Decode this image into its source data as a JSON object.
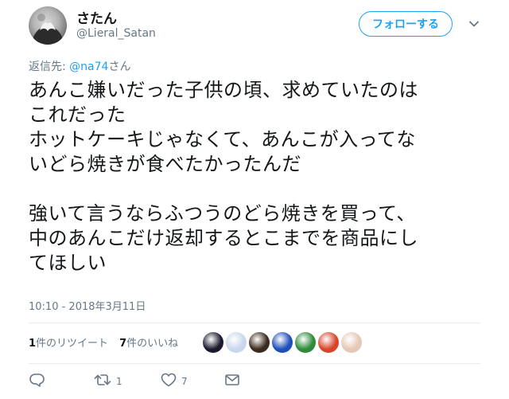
{
  "user": {
    "display_name": "さたん",
    "username": "@Lieral_Satan"
  },
  "follow_button": {
    "label": "フォローする"
  },
  "reply": {
    "prefix": "返信先: ",
    "mention": "@na74",
    "suffix": "さん"
  },
  "tweet": {
    "text": "あんこ嫌いだった子供の頃、求めていたのは\nこれだった\nホットケーキじゃなくて、あんこが入ってな\nいどら焼きが食べたかったんだ\n\n強いて言うならふつうのどら焼きを買って、\n中のあんこだけ返却するとこまでを商品にし\nてほしい",
    "timestamp": "10:10 - 2018年3月11日"
  },
  "stats": {
    "retweet_count": "1",
    "retweet_label": "件のリツイート",
    "like_count": "7",
    "like_label": "件のいいね"
  },
  "likers": [
    {
      "icon": "liker-avatar-1",
      "color": "#1a1a2e"
    },
    {
      "icon": "liker-avatar-2",
      "color": "#c9d6ec"
    },
    {
      "icon": "liker-avatar-3",
      "color": "#3b2a1e"
    },
    {
      "icon": "liker-avatar-4",
      "color": "#1f4fb8"
    },
    {
      "icon": "liker-avatar-5",
      "color": "#2e8b3a"
    },
    {
      "icon": "liker-avatar-6",
      "color": "#d8452a"
    },
    {
      "icon": "liker-avatar-7",
      "color": "#e6c7b8"
    }
  ],
  "actions": {
    "reply_icon": "reply-icon",
    "retweet_icon": "retweet-icon",
    "retweet_count": "1",
    "like_icon": "heart-icon",
    "like_count": "7",
    "dm_icon": "envelope-icon"
  },
  "colors": {
    "accent": "#1da1f2",
    "secondary_text": "#657786",
    "primary_text": "#14171a",
    "divider": "#e6ecf0"
  }
}
